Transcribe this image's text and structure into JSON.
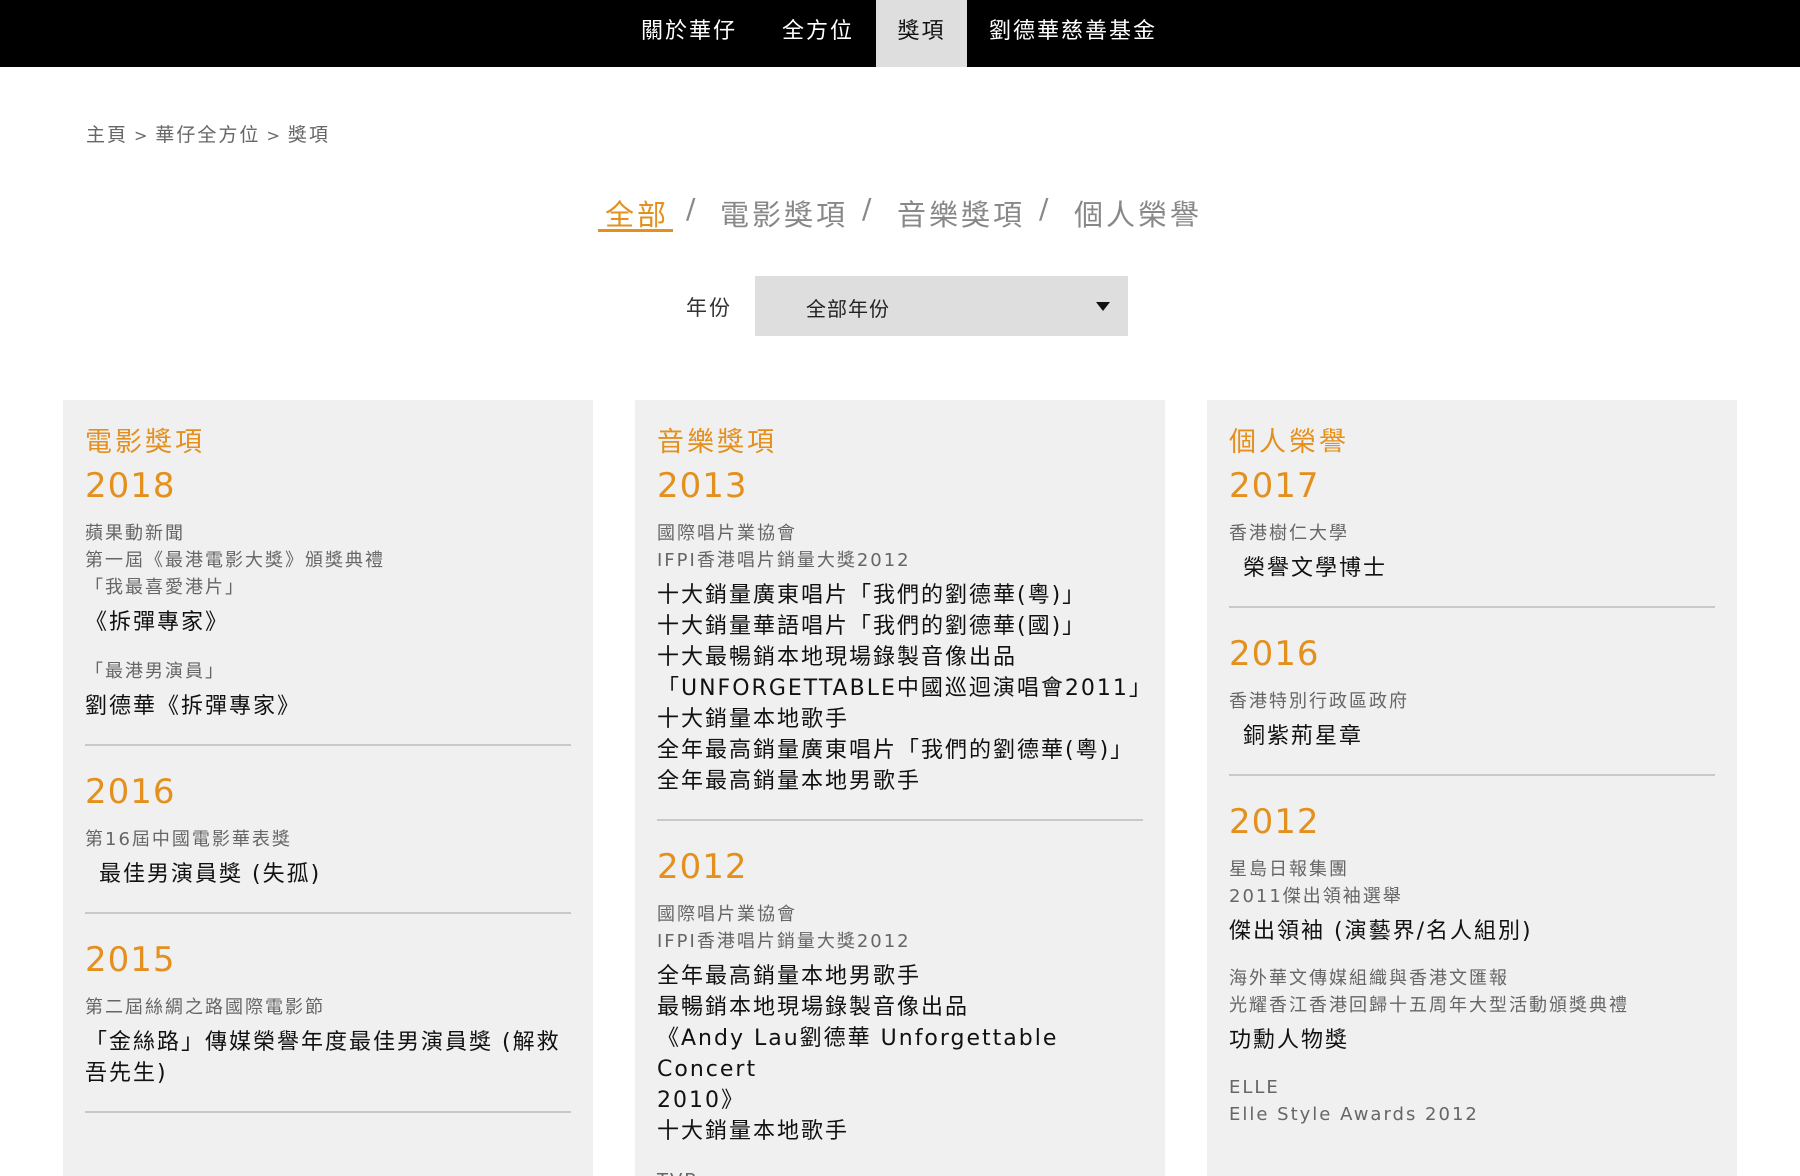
{
  "topnav": {
    "items": [
      {
        "label": "關於華仔"
      },
      {
        "label": "全方位"
      },
      {
        "label": "獎項",
        "active": true
      },
      {
        "label": "劉德華慈善基金"
      }
    ]
  },
  "breadcrumb": {
    "items": [
      "主頁",
      "華仔全方位",
      "獎項"
    ],
    "separator": ">"
  },
  "filter": {
    "tabs": [
      "全部",
      "電影獎項",
      "音樂獎項",
      "個人榮譽"
    ],
    "separator": "/",
    "active_tab": "全部",
    "year_label": "年份",
    "year_value": "全部年份"
  },
  "colors": {
    "accent": "#e3901f",
    "nav_bg": "#000000",
    "card_bg": "#f0f0f0"
  },
  "columns": [
    {
      "title": "電影獎項",
      "groups": [
        {
          "year": "2018",
          "entries": [
            {
              "org": [
                "蘋果動新聞",
                "第一屆《最港電影大獎》頒獎典禮",
                "「我最喜愛港片」"
              ],
              "awards": [
                "《拆彈專家》"
              ]
            },
            {
              "org": [
                "「最港男演員」"
              ],
              "awards": [
                "劉德華《拆彈專家》"
              ]
            }
          ]
        },
        {
          "year": "2016",
          "entries": [
            {
              "org": [
                "第16屆中國電影華表獎"
              ],
              "awards": [
                "最佳男演員獎 (失孤)"
              ]
            }
          ]
        },
        {
          "year": "2015",
          "entries": [
            {
              "org": [
                "第二屆絲綢之路國際電影節"
              ],
              "awards": [
                "「金絲路」傳媒榮譽年度最佳男演員獎 (解救",
                "吾先生)"
              ]
            }
          ]
        }
      ]
    },
    {
      "title": "音樂獎項",
      "groups": [
        {
          "year": "2013",
          "entries": [
            {
              "org": [
                "國際唱片業協會",
                "IFPI香港唱片銷量大獎2012"
              ],
              "awards": [
                "十大銷量廣東唱片「我們的劉德華(粵)」",
                "十大銷量華語唱片「我們的劉德華(國)」",
                "十大最暢銷本地現場錄製音像出品",
                "「UNFORGETTABLE中國巡迴演唱會2011」",
                "十大銷量本地歌手",
                "全年最高銷量廣東唱片「我們的劉德華(粵)」",
                "全年最高銷量本地男歌手"
              ]
            }
          ]
        },
        {
          "year": "2012",
          "entries": [
            {
              "org": [
                "國際唱片業協會",
                "IFPI香港唱片銷量大獎2012"
              ],
              "awards": [
                "全年最高銷量本地男歌手",
                "最暢銷本地現場錄製音像出品",
                "《Andy Lau劉德華 Unforgettable Concert",
                "2010》",
                "十大銷量本地歌手"
              ]
            },
            {
              "org": [
                "TVB"
              ],
              "awards": []
            }
          ]
        }
      ]
    },
    {
      "title": "個人榮譽",
      "groups": [
        {
          "year": "2017",
          "entries": [
            {
              "org": [
                "香港樹仁大學"
              ],
              "awards": [
                "榮譽文學博士"
              ]
            }
          ]
        },
        {
          "year": "2016",
          "entries": [
            {
              "org": [
                "香港特別行政區政府"
              ],
              "awards": [
                "銅紫荊星章"
              ]
            }
          ]
        },
        {
          "year": "2012",
          "entries": [
            {
              "org": [
                "星島日報集團",
                "2011傑出領袖選舉"
              ],
              "awards": [
                "傑出領袖 (演藝界/名人組別)"
              ]
            },
            {
              "org": [
                "海外華文傳媒組織與香港文匯報",
                "光耀香江香港回歸十五周年大型活動頒獎典禮"
              ],
              "awards": [
                "功勳人物獎"
              ]
            },
            {
              "org": [
                "ELLE",
                "Elle Style Awards 2012"
              ],
              "awards": []
            }
          ]
        }
      ]
    }
  ]
}
